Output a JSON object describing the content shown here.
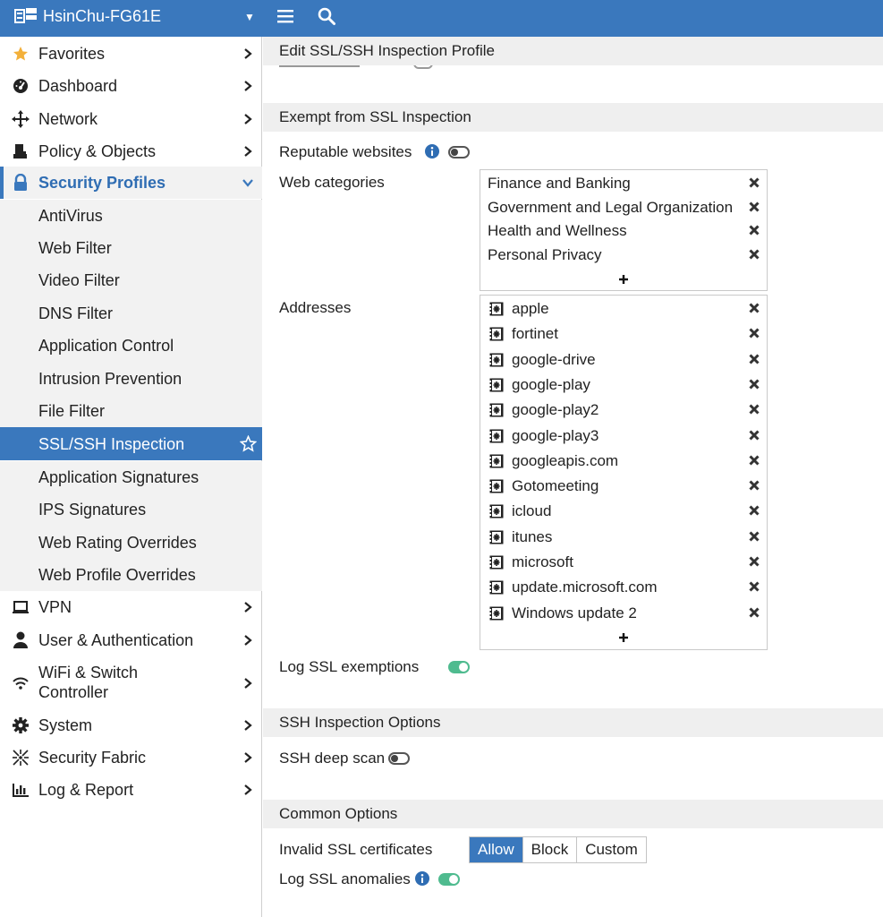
{
  "header": {
    "hostname": "HsinChu-FG61E",
    "hostname_caret": "▼"
  },
  "sidebar": {
    "top_items": [
      {
        "label": "Favorites",
        "icon": "star-icon"
      },
      {
        "label": "Dashboard",
        "icon": "dashboard-icon"
      },
      {
        "label": "Network",
        "icon": "network-icon"
      },
      {
        "label": "Policy & Objects",
        "icon": "policy-icon"
      },
      {
        "label": "Security Profiles",
        "icon": "lock-icon"
      }
    ],
    "security_profiles_sub": [
      "AntiVirus",
      "Web Filter",
      "Video Filter",
      "DNS Filter",
      "Application Control",
      "Intrusion Prevention",
      "File Filter",
      "SSL/SSH Inspection",
      "Application Signatures",
      "IPS Signatures",
      "Web Rating Overrides",
      "Web Profile Overrides"
    ],
    "bottom_items": [
      {
        "label": "VPN",
        "icon": "laptop-icon"
      },
      {
        "label": "User & Authentication",
        "icon": "user-icon"
      },
      {
        "label": "WiFi & Switch",
        "label2": "Controller",
        "icon": "wifi-icon"
      },
      {
        "label": "System",
        "icon": "gear-icon"
      },
      {
        "label": "Security Fabric",
        "icon": "fabric-icon"
      },
      {
        "label": "Log & Report",
        "icon": "chart-icon"
      }
    ],
    "accent_color": "#3a78bd"
  },
  "main": {
    "page_title": "Edit SSL/SSH Inspection Profile",
    "exempt_section": "Exempt from SSL Inspection",
    "reputable_websites_label": "Reputable websites",
    "reputable_websites_enabled": false,
    "web_categories_label": "Web categories",
    "web_categories": [
      "Finance and Banking",
      "Government and Legal Organization",
      "Health and Wellness",
      "Personal Privacy"
    ],
    "addresses_label": "Addresses",
    "addresses": [
      "apple",
      "fortinet",
      "google-drive",
      "google-play",
      "google-play2",
      "google-play3",
      "googleapis.com",
      "Gotomeeting",
      "icloud",
      "itunes",
      "microsoft",
      "update.microsoft.com",
      "Windows update 2"
    ],
    "log_ssl_exemptions_label": "Log SSL exemptions",
    "log_ssl_exemptions_enabled": true,
    "ssh_section": "SSH Inspection Options",
    "ssh_deep_scan_label": "SSH deep scan",
    "ssh_deep_scan_enabled": false,
    "common_section": "Common Options",
    "invalid_ssl_label": "Invalid SSL certificates",
    "invalid_ssl_options": [
      "Allow",
      "Block",
      "Custom"
    ],
    "invalid_ssl_selected": "Allow",
    "log_ssl_anomalies_label": "Log SSL anomalies",
    "log_ssl_anomalies_enabled": true,
    "toggle_on_color": "#4fbb8f"
  }
}
